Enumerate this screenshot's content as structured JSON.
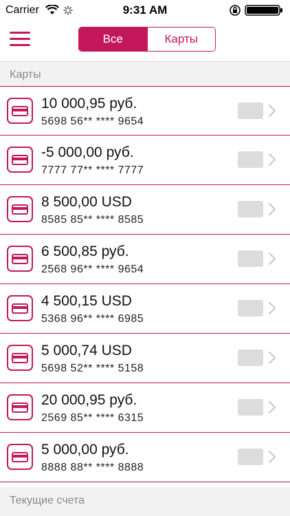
{
  "status_bar": {
    "carrier": "Carrier",
    "time": "9:31 AM"
  },
  "segmented": {
    "all_label": "Все",
    "cards_label": "Карты",
    "selected": "all"
  },
  "sections": {
    "cards_header": "Карты",
    "accounts_header": "Текущие счета"
  },
  "cards": [
    {
      "amount": "10 000,95 руб.",
      "number": "5698 56** **** 9654"
    },
    {
      "amount": "-5 000,00 руб.",
      "number": "7777 77** **** 7777"
    },
    {
      "amount": "8 500,00 USD",
      "number": "8585 85** **** 8585"
    },
    {
      "amount": "6 500,85 руб.",
      "number": "2568 96** **** 9654"
    },
    {
      "amount": "4 500,15 USD",
      "number": "5368 96** **** 6985"
    },
    {
      "amount": "5 000,74 USD",
      "number": "5698 52** **** 5158"
    },
    {
      "amount": "20 000,95 руб.",
      "number": "2569 85** **** 6315"
    },
    {
      "amount": "5 000,00 руб.",
      "number": "8888 88** **** 8888"
    }
  ],
  "colors": {
    "accent": "#c2185b",
    "section_bg": "#f2f2f2",
    "toggle_bg": "#dcdcdc"
  },
  "icons": {
    "menu": "hamburger-icon",
    "card": "credit-card-icon",
    "chevron": "chevron-right-icon"
  }
}
